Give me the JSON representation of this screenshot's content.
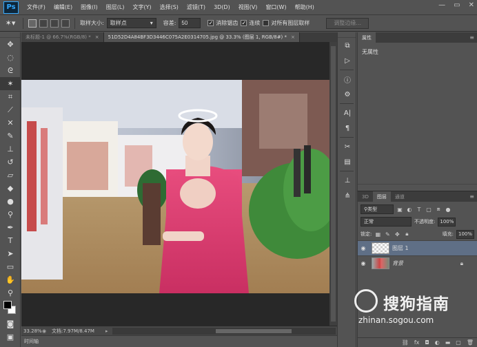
{
  "app": {
    "logo": "Ps"
  },
  "menu": [
    "文件(F)",
    "编辑(E)",
    "图像(I)",
    "图层(L)",
    "文字(Y)",
    "选择(S)",
    "滤镜(T)",
    "3D(D)",
    "视图(V)",
    "窗口(W)",
    "帮助(H)"
  ],
  "window_controls": {
    "minimize": "—",
    "restore": "▭",
    "close": "✕"
  },
  "options": {
    "sample_size_label": "取样大小:",
    "sample_size_value": "取样点",
    "tolerance_label": "容差:",
    "tolerance_value": "50",
    "anti_alias": "消除锯齿",
    "contiguous": "连续",
    "sample_all_layers": "对所有图层取样",
    "refine_edge": "调整边缘..."
  },
  "tabs": [
    {
      "label": "未标题-1 @ 66.7%(RGB/8) *",
      "close": "×"
    },
    {
      "label": "51D52D4A84BF3D3446C075A2E0314705.jpg @ 33.3% (图层 1, RGB/8#) *",
      "close": "×"
    }
  ],
  "status": {
    "zoom": "33.28%",
    "doc_size": "文档:7.97M/8.47M",
    "timeline": "时间轴"
  },
  "properties": {
    "tabs": [
      "属性"
    ],
    "body": "无属性"
  },
  "layers": {
    "tabs": [
      "3D",
      "图层",
      "通道"
    ],
    "filter_kind": "类型",
    "blend_mode": "正常",
    "opacity_label": "不透明度:",
    "opacity_value": "100%",
    "lock_label": "锁定:",
    "fill_label": "填充:",
    "fill_value": "100%",
    "items": [
      {
        "name": "图层 1"
      },
      {
        "name": "背景"
      }
    ],
    "footer_icons": [
      "link-icon",
      "fx-icon",
      "mask-icon",
      "adjustment-icon",
      "folder-icon",
      "new-layer-icon",
      "trash-icon"
    ]
  },
  "watermark": {
    "text": "搜狗指南",
    "url": "zhinan.sogou.com"
  },
  "colors": {
    "ui_bg": "#535353",
    "canvas_bg": "#282828",
    "selected_layer": "#5f6f86",
    "ps_blue": "#31a8ff"
  }
}
